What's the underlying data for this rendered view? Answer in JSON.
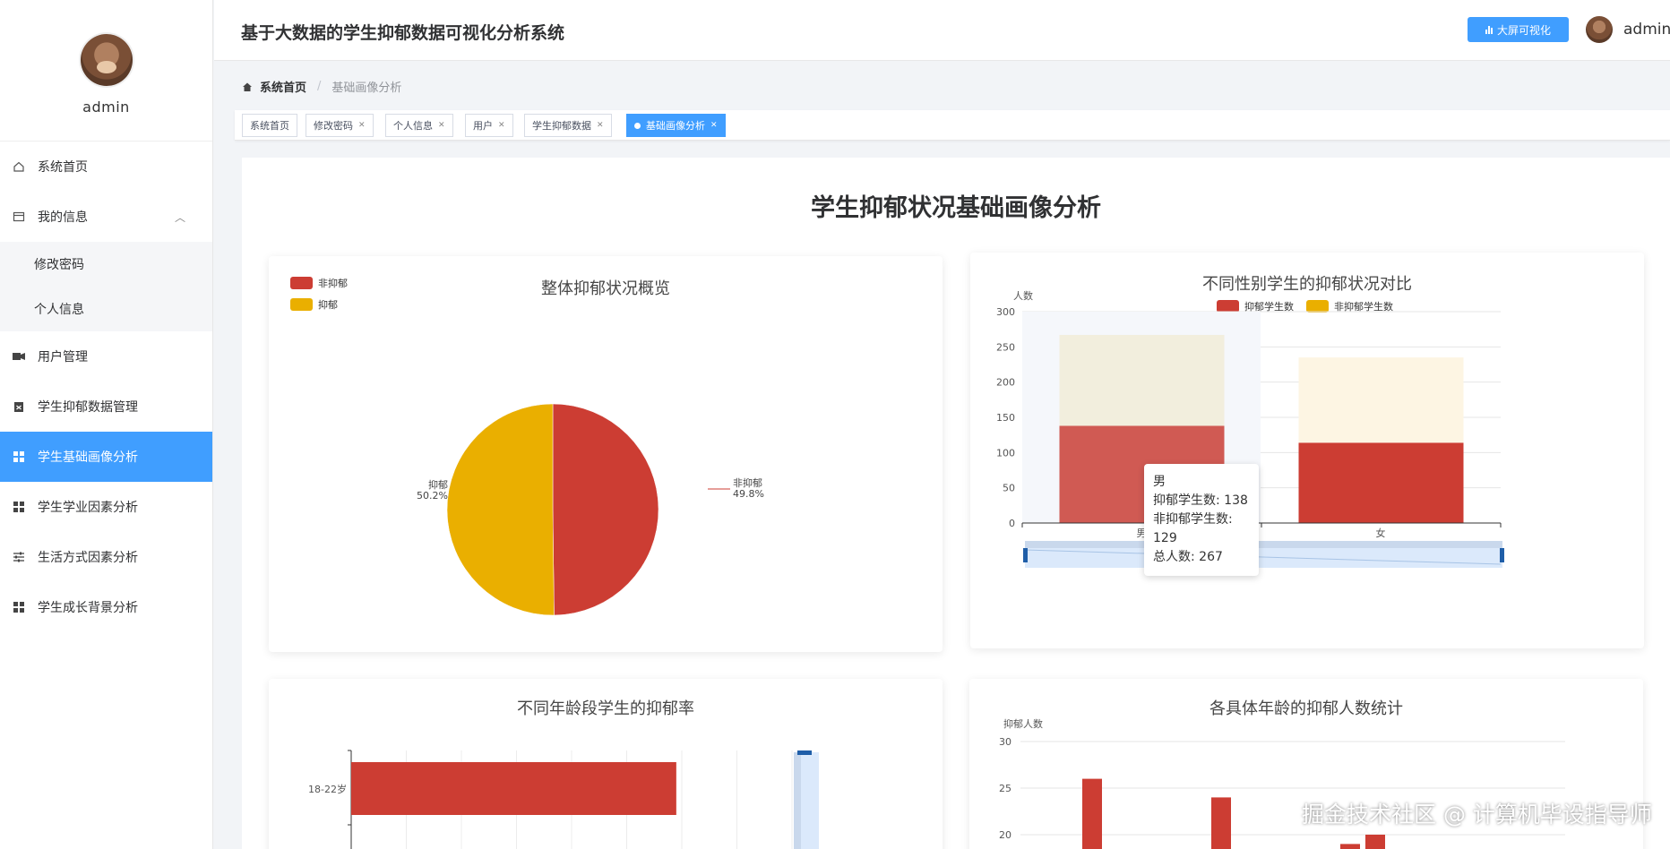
{
  "sidebar": {
    "user_name": "admin",
    "items": [
      {
        "label": "系统首页",
        "icon": "home-icon"
      },
      {
        "label": "我的信息",
        "icon": "profile-card-icon"
      },
      {
        "label": "修改密码"
      },
      {
        "label": "个人信息"
      },
      {
        "label": "用户管理",
        "icon": "users-icon"
      },
      {
        "label": "学生抑郁数据管理",
        "icon": "clipboard-icon"
      },
      {
        "label": "学生基础画像分析",
        "icon": "grid-icon",
        "active": true
      },
      {
        "label": "学生学业因素分析",
        "icon": "grid-icon"
      },
      {
        "label": "生活方式因素分析",
        "icon": "sliders-icon"
      },
      {
        "label": "学生成长背景分析",
        "icon": "grid-icon"
      }
    ]
  },
  "header": {
    "title": "基于大数据的学生抑郁数据可视化分析系统",
    "screen_button": "大屏可视化",
    "user_name": "admin"
  },
  "breadcrumb": {
    "home": "系统首页",
    "current": "基础画像分析"
  },
  "tags": [
    {
      "label": "系统首页",
      "closable": false
    },
    {
      "label": "修改密码",
      "closable": true
    },
    {
      "label": "个人信息",
      "closable": true
    },
    {
      "label": "用户",
      "closable": true
    },
    {
      "label": "学生抑郁数据",
      "closable": true
    },
    {
      "label": "基础画像分析",
      "closable": true,
      "active": true
    }
  ],
  "page": {
    "title": "学生抑郁状况基础画像分析"
  },
  "colors": {
    "red": "#cc3d33",
    "yellow": "#eaaf00",
    "accent": "#409eff"
  },
  "chart_data": [
    {
      "type": "pie",
      "title": "整体抑郁状况概览",
      "legend": [
        "非抑郁",
        "抑郁"
      ],
      "slices": [
        {
          "name": "非抑郁",
          "value": 49.8,
          "label": "49.8%",
          "color": "#cc3d33"
        },
        {
          "name": "抑郁",
          "value": 50.2,
          "label": "50.2%",
          "color": "#eaaf00"
        }
      ]
    },
    {
      "type": "bar",
      "title": "不同性别学生的抑郁状况对比",
      "ylabel": "人数",
      "categories": [
        "男",
        "女"
      ],
      "ylim": [
        0,
        300
      ],
      "yticks": [
        "0",
        "50",
        "100",
        "150",
        "200",
        "250",
        "300"
      ],
      "stacked": true,
      "series": [
        {
          "name": "抑郁学生数",
          "values": [
            138,
            114
          ],
          "color": "#cc3d33"
        },
        {
          "name": "非抑郁学生数",
          "values": [
            129,
            121
          ],
          "color": "#eaaf00"
        }
      ],
      "tooltip": {
        "title": "男",
        "lines": [
          "抑郁学生数: 138",
          "非抑郁学生数: 129",
          "总人数: 267"
        ]
      }
    },
    {
      "type": "bar",
      "title": "不同年龄段学生的抑郁率",
      "orientation": "horizontal",
      "categories": [
        "18-22岁"
      ],
      "values": [
        59
      ],
      "color": "#cc3d33"
    },
    {
      "type": "bar",
      "title": "各具体年龄的抑郁人数统计",
      "ylabel": "抑郁人数",
      "ylim": [
        15,
        30
      ],
      "yticks": [
        "20",
        "25",
        "30"
      ],
      "values": [
        26,
        24,
        19,
        20
      ],
      "color": "#cc3d33"
    }
  ],
  "watermark": "掘金技术社区 @ 计算机毕设指导师"
}
